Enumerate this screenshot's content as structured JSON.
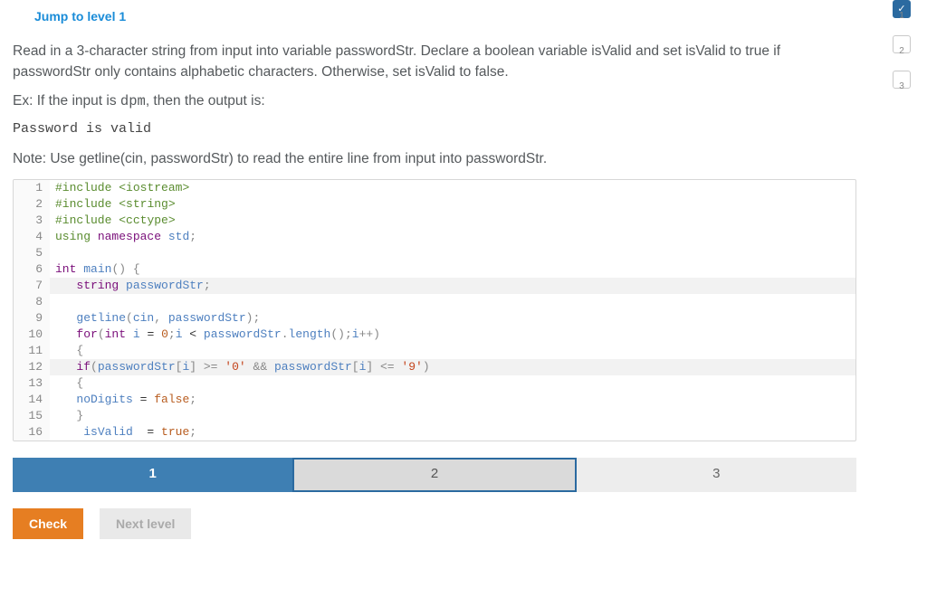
{
  "jump_link": "Jump to level 1",
  "instructions": {
    "p1": "Read in a 3-character string from input into variable passwordStr. Declare a boolean variable isValid and set isValid to true if passwordStr only contains alphabetic characters. Otherwise, set isValid to false.",
    "p2_prefix": "Ex: If the input is ",
    "p2_code": "dpm",
    "p2_suffix": ", then the output is:",
    "example_output": "Password is valid",
    "note": "Note: Use getline(cin, passwordStr) to read the entire line from input into passwordStr."
  },
  "code_lines": [
    {
      "n": "1",
      "tokens": [
        [
          "inc",
          "#include"
        ],
        [
          "typ",
          " "
        ],
        [
          "hdr",
          "<iostream>"
        ]
      ]
    },
    {
      "n": "2",
      "tokens": [
        [
          "inc",
          "#include"
        ],
        [
          "typ",
          " "
        ],
        [
          "hdr",
          "<string>"
        ]
      ]
    },
    {
      "n": "3",
      "tokens": [
        [
          "inc",
          "#include"
        ],
        [
          "typ",
          " "
        ],
        [
          "hdr",
          "<cctype>"
        ]
      ]
    },
    {
      "n": "4",
      "tokens": [
        [
          "inc",
          "using"
        ],
        [
          "typ",
          " "
        ],
        [
          "kw",
          "namespace"
        ],
        [
          "typ",
          " "
        ],
        [
          "id",
          "std"
        ],
        [
          "pun",
          ";"
        ]
      ]
    },
    {
      "n": "5",
      "tokens": []
    },
    {
      "n": "6",
      "tokens": [
        [
          "kw",
          "int"
        ],
        [
          "typ",
          " "
        ],
        [
          "fn",
          "main"
        ],
        [
          "pun",
          "() {"
        ]
      ]
    },
    {
      "n": "7",
      "tokens": [
        [
          "typ",
          "   "
        ],
        [
          "kw",
          "string"
        ],
        [
          "typ",
          " "
        ],
        [
          "id",
          "passwordStr"
        ],
        [
          "pun",
          ";"
        ]
      ],
      "hl": true
    },
    {
      "n": "8",
      "tokens": []
    },
    {
      "n": "9",
      "tokens": [
        [
          "typ",
          "   "
        ],
        [
          "fn",
          "getline"
        ],
        [
          "pun",
          "("
        ],
        [
          "id",
          "cin"
        ],
        [
          "pun",
          ", "
        ],
        [
          "id",
          "passwordStr"
        ],
        [
          "pun",
          ");"
        ]
      ]
    },
    {
      "n": "10",
      "tokens": [
        [
          "typ",
          "   "
        ],
        [
          "kw",
          "for"
        ],
        [
          "pun",
          "("
        ],
        [
          "kw",
          "int"
        ],
        [
          "typ",
          " "
        ],
        [
          "id",
          "i"
        ],
        [
          "typ",
          " = "
        ],
        [
          "num",
          "0"
        ],
        [
          "pun",
          ";"
        ],
        [
          "id",
          "i"
        ],
        [
          "typ",
          " < "
        ],
        [
          "id",
          "passwordStr"
        ],
        [
          "pun",
          "."
        ],
        [
          "fn",
          "length"
        ],
        [
          "pun",
          "();"
        ],
        [
          "id",
          "i"
        ],
        [
          "pun",
          "++)"
        ]
      ]
    },
    {
      "n": "11",
      "tokens": [
        [
          "typ",
          "   "
        ],
        [
          "pun",
          "{"
        ]
      ]
    },
    {
      "n": "12",
      "tokens": [
        [
          "typ",
          "   "
        ],
        [
          "kw",
          "if"
        ],
        [
          "pun",
          "("
        ],
        [
          "id",
          "passwordStr"
        ],
        [
          "pun",
          "["
        ],
        [
          "id",
          "i"
        ],
        [
          "pun",
          "] >= "
        ],
        [
          "ch",
          "'0'"
        ],
        [
          "typ",
          " "
        ],
        [
          "pun",
          "&&"
        ],
        [
          "typ",
          " "
        ],
        [
          "id",
          "passwordStr"
        ],
        [
          "pun",
          "["
        ],
        [
          "id",
          "i"
        ],
        [
          "pun",
          "] <= "
        ],
        [
          "ch",
          "'9'"
        ],
        [
          "pun",
          ")"
        ]
      ],
      "hl": true
    },
    {
      "n": "13",
      "tokens": [
        [
          "typ",
          "   "
        ],
        [
          "pun",
          "{"
        ]
      ]
    },
    {
      "n": "14",
      "tokens": [
        [
          "typ",
          "   "
        ],
        [
          "id",
          "noDigits"
        ],
        [
          "typ",
          " = "
        ],
        [
          "bool",
          "false"
        ],
        [
          "pun",
          ";"
        ]
      ]
    },
    {
      "n": "15",
      "tokens": [
        [
          "typ",
          "   "
        ],
        [
          "pun",
          "}"
        ]
      ]
    },
    {
      "n": "16",
      "tokens": [
        [
          "typ",
          "    "
        ],
        [
          "id",
          "isValid"
        ],
        [
          "typ",
          "  = "
        ],
        [
          "bool",
          "true"
        ],
        [
          "pun",
          ";"
        ]
      ]
    }
  ],
  "steptabs": [
    {
      "label": "1",
      "state": "active"
    },
    {
      "label": "2",
      "state": "focused"
    },
    {
      "label": "3",
      "state": "plain"
    }
  ],
  "buttons": {
    "check": "Check",
    "next": "Next level"
  },
  "progress": [
    {
      "label": "1",
      "done": true,
      "glyph": "✓"
    },
    {
      "label": "2",
      "done": false
    },
    {
      "label": "3",
      "done": false
    }
  ]
}
